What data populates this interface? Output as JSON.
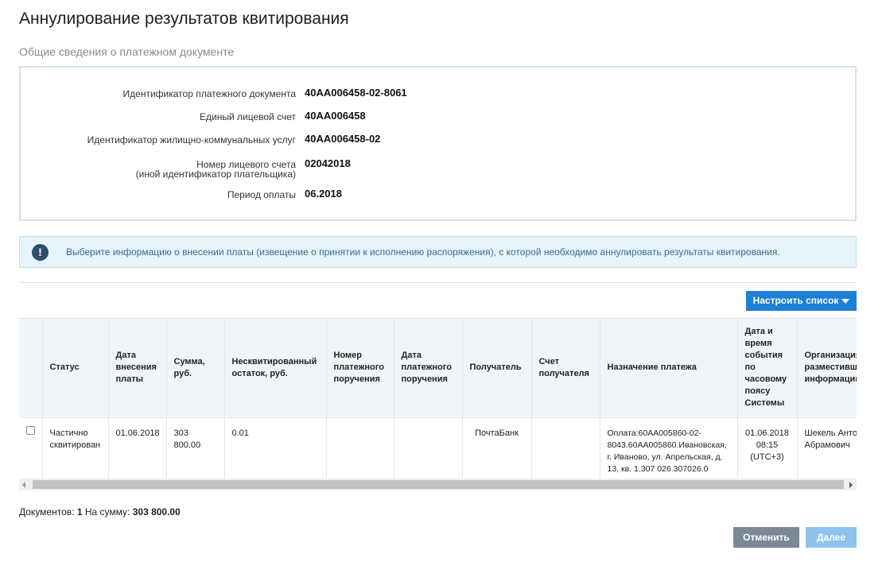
{
  "page": {
    "title": "Аннулирование результатов квитирования",
    "section_title": "Общие сведения о платежном документе"
  },
  "info": {
    "rows": [
      {
        "label": "Идентификатор платежного документа",
        "value": "40АА006458-02-8061"
      },
      {
        "label": "Единый лицевой счет",
        "value": "40АА006458"
      },
      {
        "label": "Идентификатор жилищно-коммунальных услуг",
        "value": "40АА006458-02"
      },
      {
        "label_line1": "Номер лицевого счета",
        "label_line2": "(иной идентификатор плательщика)",
        "value": "02042018"
      },
      {
        "label": "Период оплаты",
        "value": "06.2018"
      }
    ]
  },
  "alert": {
    "icon": "exclamation-icon",
    "glyph": "!",
    "text": "Выберите информацию о внесении платы (извещение о принятии к исполнению распоряжения), с которой необходимо аннулировать результаты квитирования."
  },
  "toolbar": {
    "configure_label": "Настроить список"
  },
  "table": {
    "columns": [
      "Статус",
      "Дата внесения платы",
      "Сумма, руб.",
      "Несквитированный остаток, руб.",
      "Номер платежного поручения",
      "Дата платежного поручения",
      "Получатель",
      "Счет получателя",
      "Назначение платежа",
      "Дата и время события по часовому поясу Системы",
      "Организация, разместившая информацию"
    ],
    "rows": [
      {
        "status": "Частично сквитирован",
        "date": "01.06.2018",
        "sum": "303 800.00",
        "remainder": "0.01",
        "order_number": "",
        "order_date": "",
        "recipient": "ПочтаБанк",
        "recipient_account": "",
        "purpose": "Оплата:60АА005860-02-8043.60АА005860.Ивановская, г. Иваново, ул. Апрельская, д. 13, кв. 1.307 026.307026.0",
        "event_time": "01.06.2018 08:15 (UTC+3)",
        "organization": "Шекель Антон Абрамович"
      }
    ]
  },
  "summary": {
    "documents_label": "Документов:",
    "documents_count": "1",
    "sum_label": "На сумму:",
    "sum_value": "303 800.00"
  },
  "footer": {
    "cancel_label": "Отменить",
    "next_label": "Далее"
  },
  "colors": {
    "primary": "#1e7fd5",
    "cancel": "#7c8894",
    "next_disabled": "#8ec3ee",
    "alert_bg": "#e6f4f9",
    "alert_icon": "#2e4e6e"
  }
}
